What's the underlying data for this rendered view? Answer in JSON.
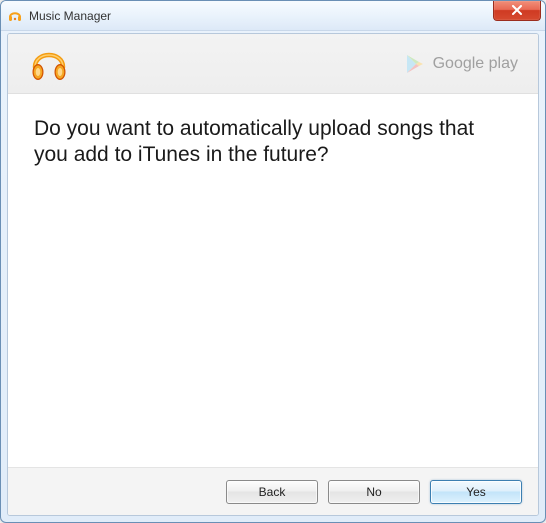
{
  "window": {
    "title": "Music Manager"
  },
  "brand": {
    "label": "Google play"
  },
  "content": {
    "question": "Do you want to automatically upload songs that you add to iTunes in the future?"
  },
  "buttons": {
    "back": "Back",
    "no": "No",
    "yes": "Yes"
  }
}
